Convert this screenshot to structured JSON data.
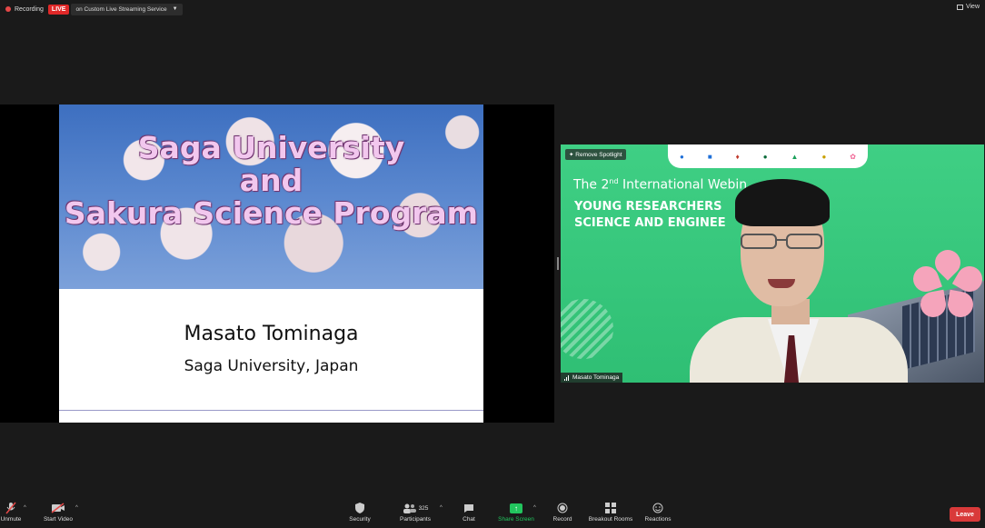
{
  "status_bar": {
    "recording_label": "Recording",
    "live_badge": "LIVE",
    "stream_label": "on Custom Live Streaming Service",
    "view_label": "View"
  },
  "slide": {
    "title_lines": [
      "Saga University",
      "and",
      "Sakura Science Program"
    ],
    "presenter_name": "Masato Tominaga",
    "affiliation": "Saga University, Japan"
  },
  "video": {
    "remove_spotlight": "Remove Spotlight",
    "banner_line_prefix": "The 2",
    "banner_line_sup": "nd",
    "banner_line_suffix": "International Webin",
    "banner_heading_1": "YOUNG RESEARCHERS",
    "banner_heading_1_tail": "S",
    "banner_heading_2": "SCIENCE AND ENGINEE",
    "participant_name": "Masato Tominaga"
  },
  "toolbar": {
    "unmute": "Unmute",
    "start_video": "Start Video",
    "security": "Security",
    "participants": "Participants",
    "participant_count": "325",
    "chat": "Chat",
    "share_screen": "Share Screen",
    "record": "Record",
    "breakout_rooms": "Breakout Rooms",
    "reactions": "Reactions",
    "leave": "Leave"
  },
  "colors": {
    "live_red": "#e02828",
    "share_green": "#22c55e",
    "leave_red": "#d93a3a",
    "banner_green": "#33c67a"
  }
}
